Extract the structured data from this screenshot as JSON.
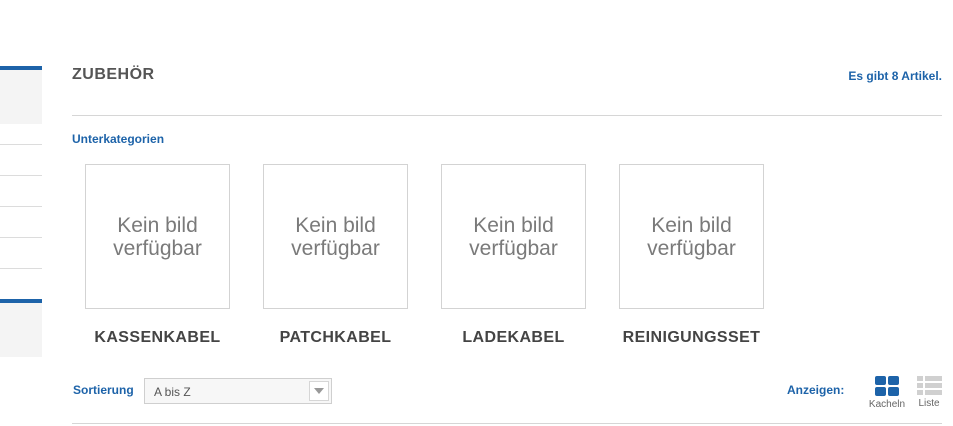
{
  "category": {
    "title": "ZUBEHÖR",
    "article_count": "Es gibt 8 Artikel."
  },
  "subcategories": {
    "label": "Unterkategorien",
    "items": [
      {
        "placeholder": "Kein bild verfügbar",
        "name": "KASSENKABEL"
      },
      {
        "placeholder": "Kein bild verfügbar",
        "name": "PATCHKABEL"
      },
      {
        "placeholder": "Kein bild verfügbar",
        "name": "LADEKABEL"
      },
      {
        "placeholder": "Kein bild verfügbar",
        "name": "REINIGUNGSSET"
      }
    ]
  },
  "toolbar": {
    "sort_label": "Sortierung",
    "sort_value": "A bis Z",
    "show_label": "Anzeigen:",
    "view_grid_label": "Kacheln",
    "view_list_label": "Liste"
  },
  "colors": {
    "accent": "#1d63a9",
    "text": "#444444",
    "border": "#d3d3d3"
  }
}
